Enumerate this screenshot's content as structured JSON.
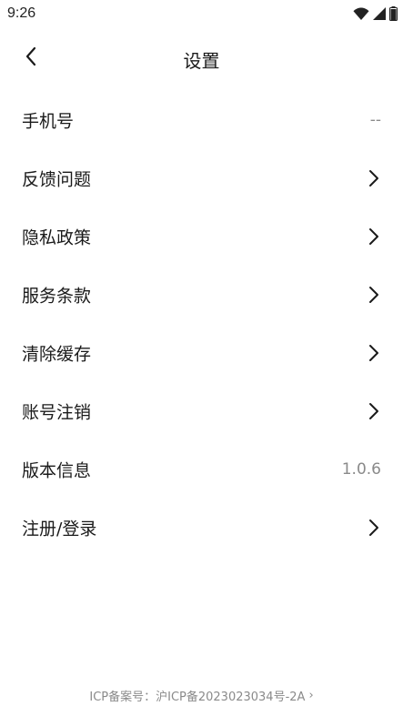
{
  "status_bar": {
    "time": "9:26",
    "icons": [
      "wifi-icon",
      "signal-icon",
      "battery-icon"
    ]
  },
  "header": {
    "title": "设置",
    "back_icon": "chevron-left-icon"
  },
  "settings": {
    "rows": [
      {
        "label": "手机号",
        "value": "--",
        "chevron": false
      },
      {
        "label": "反馈问题",
        "value": "",
        "chevron": true
      },
      {
        "label": "隐私政策",
        "value": "",
        "chevron": true
      },
      {
        "label": "服务条款",
        "value": "",
        "chevron": true
      },
      {
        "label": "清除缓存",
        "value": "",
        "chevron": true
      },
      {
        "label": "账号注销",
        "value": "",
        "chevron": true
      },
      {
        "label": "版本信息",
        "value": "1.0.6",
        "chevron": false
      },
      {
        "label": "注册/登录",
        "value": "",
        "chevron": true
      }
    ]
  },
  "footer": {
    "icp_text": "ICP备案号：沪ICP备2023023034号-2A",
    "arrow": "›"
  },
  "colors": {
    "text_primary": "#1a1a1a",
    "text_secondary": "#8a8a8a",
    "background": "#ffffff"
  }
}
